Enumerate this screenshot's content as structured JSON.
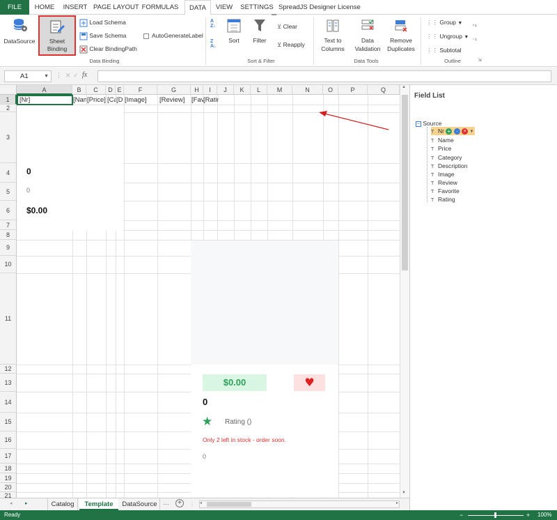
{
  "ribbon_tabs": [
    "FILE",
    "HOME",
    "INSERT",
    "PAGE LAYOUT",
    "FORMULAS",
    "DATA",
    "VIEW",
    "SETTINGS",
    "SpreadJS Designer License"
  ],
  "ribbon": {
    "datasource_label": "DataSource",
    "sheet_binding_label_1": "Sheet",
    "sheet_binding_label_2": "Binding",
    "load_schema": "Load Schema",
    "save_schema": "Save Schema",
    "clear_binding_path": "Clear BindingPath",
    "auto_generate_label": "AutoGenerateLabel",
    "group_data_binding": "Data Binding",
    "sort_label": "Sort",
    "filter_label": "Filter",
    "clear_label": "Clear",
    "reapply_label": "Reapply",
    "group_sort_filter": "Sort & Filter",
    "text_to_columns_1": "Text to",
    "text_to_columns_2": "Columns",
    "data_validation_1": "Data",
    "data_validation_2": "Validation",
    "remove_duplicates_1": "Remove",
    "remove_duplicates_2": "Duplicates",
    "group_data_tools": "Data Tools",
    "group_label": "Group",
    "ungroup_label": "Ungroup",
    "subtotal_label": "Subtotal",
    "group_outline": "Outline"
  },
  "formula_bar": {
    "name_box": "A1",
    "fx": "fx",
    "value": ""
  },
  "columns": [
    "A",
    "B",
    "C",
    "D",
    "E",
    "F",
    "G",
    "H",
    "I",
    "J",
    "K",
    "L",
    "M",
    "N",
    "O",
    "P",
    "Q"
  ],
  "rows": [
    "1",
    "2",
    "3",
    "4",
    "5",
    "6",
    "7",
    "8",
    "9",
    "10",
    "11",
    "12",
    "13",
    "14",
    "15",
    "16",
    "17",
    "18",
    "19",
    "20",
    "21"
  ],
  "cells": {
    "a1": "[Nr]",
    "b1": "[Nan",
    "c1": "[Price]",
    "d1": "[Ca",
    "e1": "[D",
    "f1": "[Image]",
    "g1": "[Review]",
    "h1": "[Fav",
    "i1": "[Ratin",
    "a4": "0",
    "a5": "0",
    "a6": "$0.00"
  },
  "card": {
    "price": "$0.00",
    "heart": "♥",
    "number": "0",
    "star": "★",
    "rating": "Rating ()",
    "stock_msg": "Only 2 left in stock - order soon.",
    "zero": "0"
  },
  "sheet_tabs": [
    "Catalog",
    "Template",
    "DataSource"
  ],
  "active_sheet": "Template",
  "field_list": {
    "title": "Field List",
    "root": "Source",
    "fields": [
      "Nr",
      "Name",
      "Price",
      "Category",
      "Description",
      "Image",
      "Review",
      "Favorite",
      "Rating"
    ]
  },
  "status": {
    "left": "Ready",
    "zoom": "100%"
  },
  "colors": {
    "accent": "#217346",
    "highlight_box": "#e03030",
    "price_bg": "#d9f5e3",
    "price_text": "#2ea05a",
    "heart_bg": "#fde0e0",
    "heart": "#e02020",
    "star": "#2ea05a",
    "stock": "#e03030"
  }
}
